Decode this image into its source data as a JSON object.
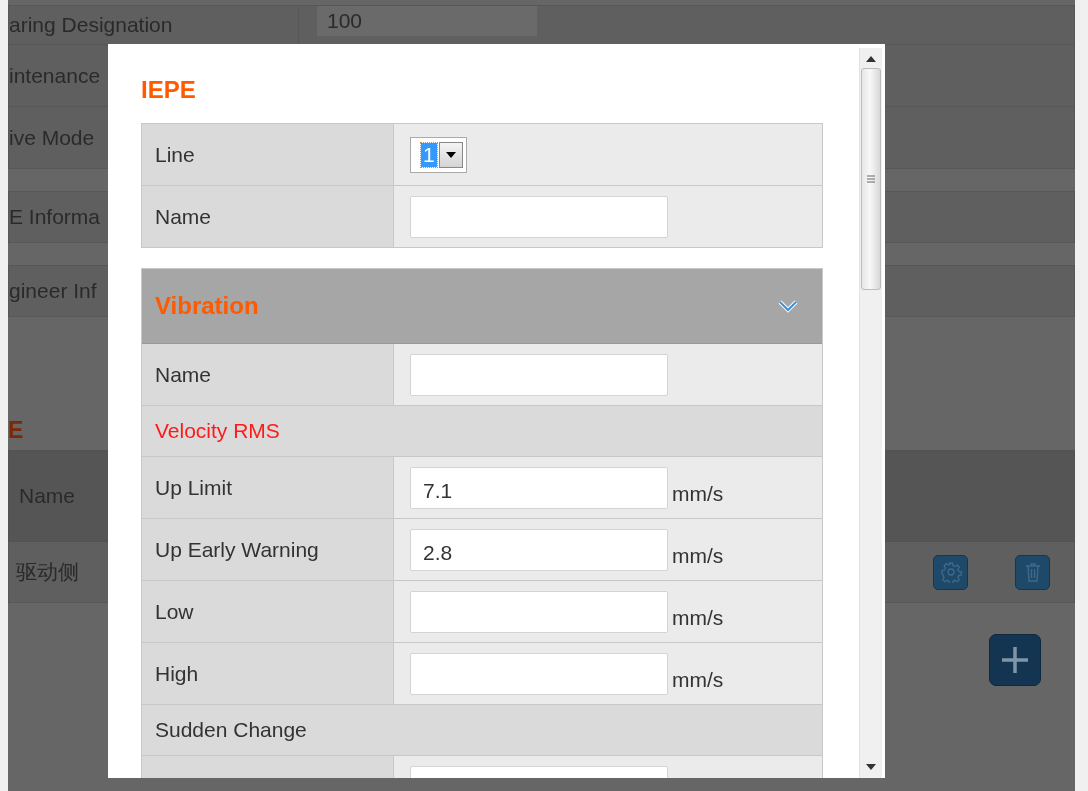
{
  "background": {
    "rows": [
      {
        "label": "aring Designation",
        "value": "100"
      },
      {
        "label": "intenance"
      },
      {
        "label": "ive Mode"
      }
    ],
    "sections": [
      "E Informa",
      "gineer Inf"
    ],
    "heading": "E",
    "table": {
      "columns": [
        "Name"
      ],
      "rows": [
        {
          "name": "驱动侧"
        }
      ]
    }
  },
  "dialog": {
    "title": "IEPE",
    "fields": [
      {
        "kind": "select",
        "label": "Line",
        "value": "1"
      },
      {
        "kind": "text",
        "label": "Name"
      }
    ],
    "panel": {
      "title": "Vibration",
      "expanded": true,
      "rows": [
        {
          "kind": "text",
          "label": "Name"
        },
        {
          "kind": "heading",
          "label": "Velocity RMS",
          "color": "#ff1a1a"
        },
        {
          "kind": "text",
          "label": "Up Limit",
          "value": "7.1",
          "unit": "mm/s"
        },
        {
          "kind": "text",
          "label": "Up Early Warning",
          "value": "2.8",
          "unit": "mm/s"
        },
        {
          "kind": "text",
          "label": "Low",
          "unit": "mm/s"
        },
        {
          "kind": "text",
          "label": "High",
          "unit": "mm/s"
        },
        {
          "kind": "heading",
          "label": "Sudden Change",
          "color": "#333333"
        },
        {
          "kind": "text"
        }
      ]
    }
  }
}
